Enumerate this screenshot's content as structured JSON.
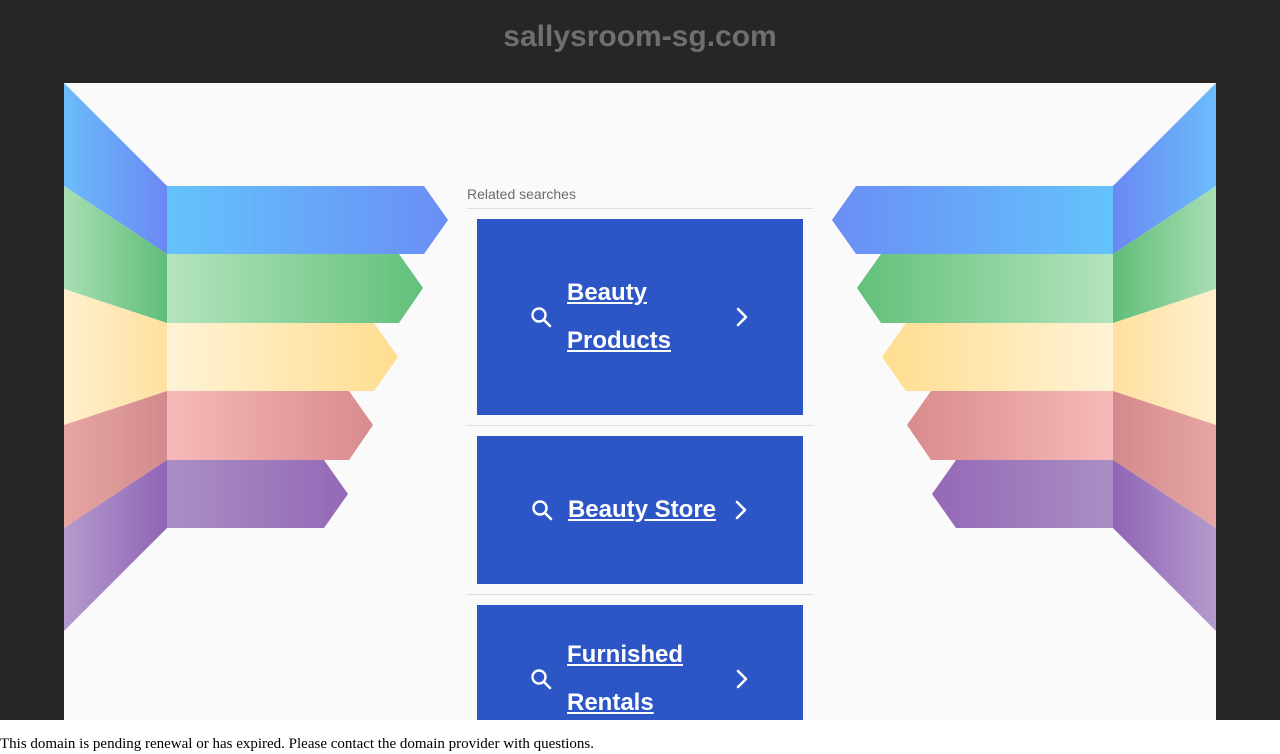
{
  "header": {
    "site_title": "sallysroom-sg.com"
  },
  "related": {
    "heading": "Related searches",
    "items": [
      {
        "label": "Beauty Products"
      },
      {
        "label": "Beauty Store"
      },
      {
        "label": "Furnished Rentals"
      }
    ]
  },
  "footer": {
    "notice": "This domain is pending renewal or has expired. Please contact the domain provider with questions."
  },
  "colors": {
    "page_bg": "#262626",
    "panel_bg": "#fafafa",
    "result_bg": "#2c55c6",
    "stripe_blue": "#6a90f5",
    "stripe_green": "#6cc486",
    "stripe_yellow": "#ffe19a",
    "stripe_pink": "#e3999a",
    "stripe_purple": "#9c79bd"
  }
}
